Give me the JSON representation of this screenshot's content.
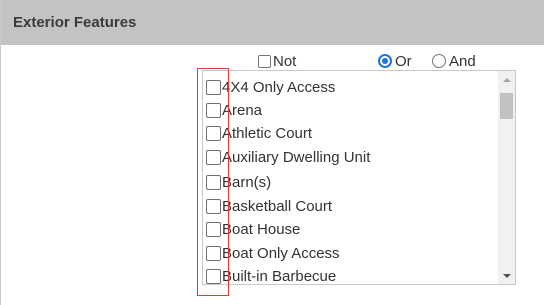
{
  "header": {
    "title": "Exterior Features"
  },
  "options": {
    "not_label": "Not",
    "or_label": "Or",
    "and_label": "And",
    "not_checked": false,
    "logic_selected": "Or"
  },
  "list": {
    "items": [
      {
        "label": "4X4 Only Access",
        "checked": false
      },
      {
        "label": "Arena",
        "checked": false
      },
      {
        "label": "Athletic Court",
        "checked": false
      },
      {
        "label": "Auxiliary Dwelling Unit",
        "checked": false
      },
      {
        "label": "Barn(s)",
        "checked": false
      },
      {
        "label": "Basketball Court",
        "checked": false
      },
      {
        "label": "Boat House",
        "checked": false
      },
      {
        "label": "Boat Only Access",
        "checked": false
      },
      {
        "label": "Built-in Barbecue",
        "checked": false
      }
    ]
  },
  "colors": {
    "header_bg": "#c3c3c3",
    "radio_accent": "#1a73e8",
    "highlight_border": "#e03a3a"
  }
}
